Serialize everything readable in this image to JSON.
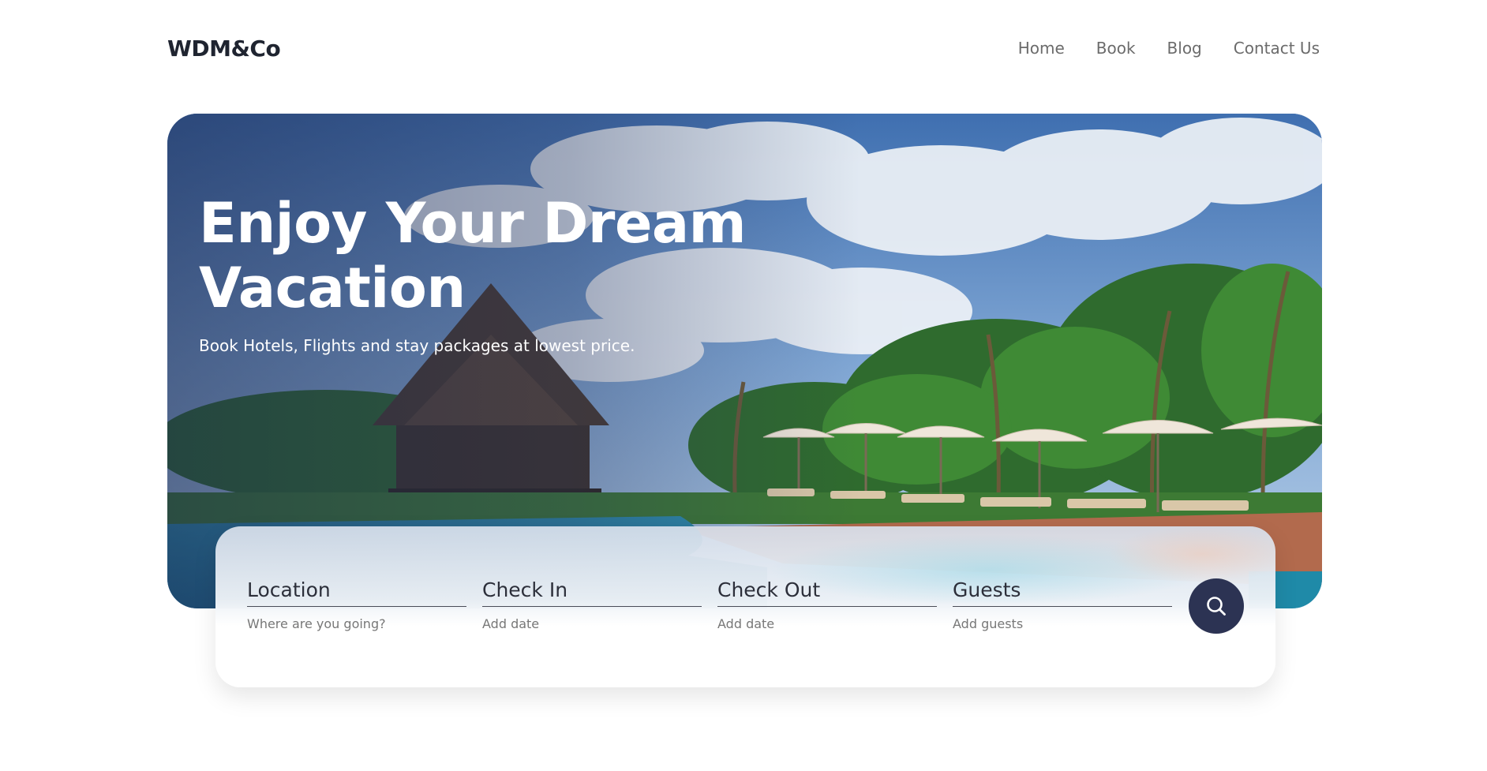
{
  "header": {
    "logo": "WDM&Co",
    "nav": [
      "Home",
      "Book",
      "Blog",
      "Contact Us"
    ]
  },
  "hero": {
    "title": "Enjoy Your Dream Vacation",
    "subtitle": "Book Hotels, Flights and stay packages at lowest price."
  },
  "search": {
    "fields": [
      {
        "label": "Location",
        "placeholder": "Where are you going?"
      },
      {
        "label": "Check In",
        "placeholder": "Add date"
      },
      {
        "label": "Check Out",
        "placeholder": "Add date"
      },
      {
        "label": "Guests",
        "placeholder": "Add guests"
      }
    ],
    "button_icon": "search-icon"
  },
  "colors": {
    "brand_dark": "#2c3353",
    "text_dark": "#1f2430",
    "nav_text": "#6b6b6b"
  }
}
